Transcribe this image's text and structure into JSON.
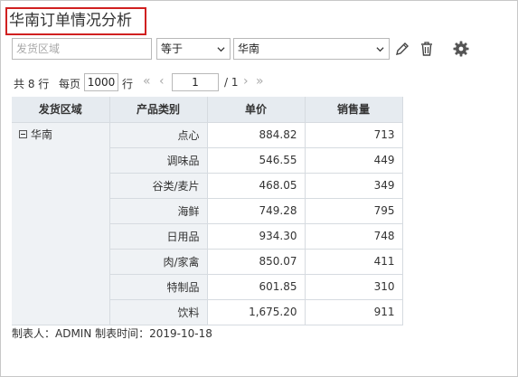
{
  "title": "华南订单情况分析",
  "filter": {
    "field_placeholder": "发货区域",
    "operator": "等于",
    "value": "华南"
  },
  "icons": {
    "edit": "pencil-icon",
    "delete": "trash-icon",
    "settings": "gear-icon"
  },
  "pager": {
    "total": "共 8 行",
    "per_page_label": "每页",
    "page_size": "1000",
    "rows_unit": "行",
    "first": "«",
    "prev": "‹",
    "current_page": "1",
    "of_pages": "/ 1",
    "next": "›",
    "last": "»"
  },
  "table": {
    "headers": [
      "发货区域",
      "产品类别",
      "单价",
      "销售量"
    ],
    "region": "华南",
    "rows": [
      {
        "category": "点心",
        "price": "884.82",
        "qty": "713"
      },
      {
        "category": "调味品",
        "price": "546.55",
        "qty": "449"
      },
      {
        "category": "谷类/麦片",
        "price": "468.05",
        "qty": "349"
      },
      {
        "category": "海鲜",
        "price": "749.28",
        "qty": "795"
      },
      {
        "category": "日用品",
        "price": "934.30",
        "qty": "748"
      },
      {
        "category": "肉/家禽",
        "price": "850.07",
        "qty": "411"
      },
      {
        "category": "特制品",
        "price": "601.85",
        "qty": "310"
      },
      {
        "category": "饮料",
        "price": "1,675.20",
        "qty": "911"
      }
    ]
  },
  "footer": "制表人：ADMIN  制表时间：2019-10-18"
}
